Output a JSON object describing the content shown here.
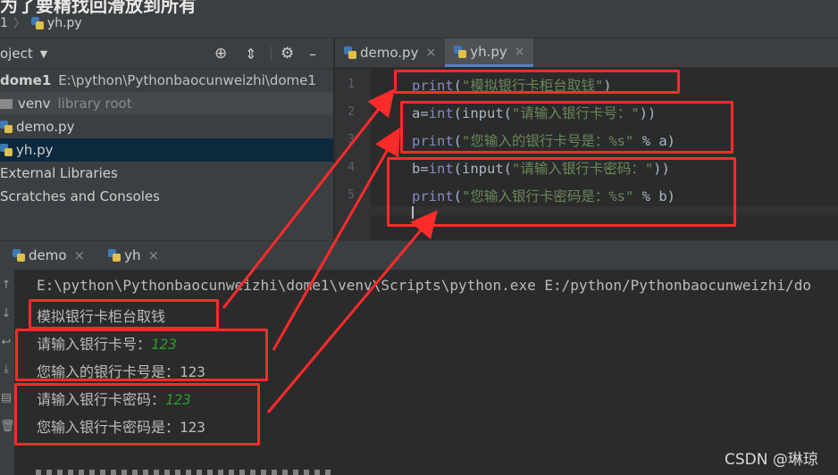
{
  "window": {
    "cut_title": "为了要精找回滑放到所有",
    "breadcrumb": {
      "root": "1",
      "file": "yh.py"
    }
  },
  "project_panel": {
    "header_label": "oject",
    "tree": [
      {
        "label": "dome1",
        "detail": "E:\\python\\Pythonbaocunweizhi\\dome1"
      },
      {
        "label": "venv",
        "detail": "library root"
      },
      {
        "label": "demo.py"
      },
      {
        "label": "yh.py"
      },
      {
        "label": "External Libraries"
      },
      {
        "label": "Scratches and Consoles"
      }
    ]
  },
  "editor": {
    "tabs": [
      {
        "label": "demo.py",
        "close": "×"
      },
      {
        "label": "yh.py",
        "close": "×"
      }
    ],
    "line_numbers": [
      "1",
      "2",
      "3",
      "4",
      "5"
    ],
    "lines": [
      {
        "pre": "",
        "fn": "print",
        "open": "(",
        "str": "\"模拟银行卡柜台取钱\"",
        "rest": ")"
      },
      {
        "pre": "a=",
        "fn": "int",
        "open": "(input(",
        "str": "\"请输入银行卡号：\"",
        "rest": "))"
      },
      {
        "pre": "",
        "fn": "print",
        "open": "(",
        "str": "\"您输入的银行卡号是：%s\"",
        "rest": " % a)"
      },
      {
        "pre": "b=",
        "fn": "int",
        "open": "(input(",
        "str": "\"请输入银行卡密码：\"",
        "rest": "))"
      },
      {
        "pre": "",
        "fn": "print",
        "open": "(",
        "str": "\"您输入银行卡密码是：%s\"",
        "rest": " % b)"
      }
    ]
  },
  "run_panel": {
    "tabs": [
      {
        "label": "demo",
        "close": "×"
      },
      {
        "label": "yh",
        "close": "×"
      }
    ],
    "output": {
      "command": "E:\\python\\Pythonbaocunweizhi\\dome1\\venv\\Scripts\\python.exe E:/python/Pythonbaocunweizhi/do",
      "line1": "模拟银行卡柜台取钱",
      "line2_prompt": "请输入银行卡号：",
      "line2_value": "123",
      "line3": "您输入的银行卡号是：123",
      "line4_prompt": "请输入银行卡密码：",
      "line4_value": "123",
      "line5": "您输入银行卡密码是：123"
    }
  },
  "watermark": "CSDN @琳琼",
  "colors": {
    "highlight": "#ff2a2a",
    "keyword": "#8888c6",
    "string": "#6a8759",
    "input_value": "#2a9d2a"
  }
}
